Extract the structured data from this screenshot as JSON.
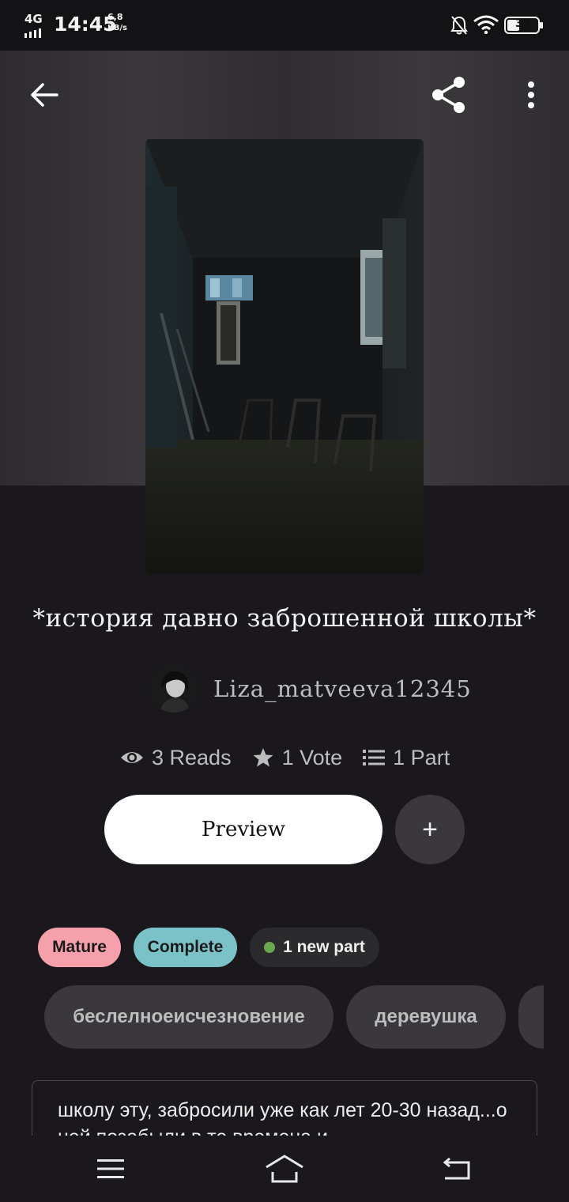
{
  "status_bar": {
    "network": "4G",
    "time": "14:45",
    "speed_value": "6,8",
    "speed_unit": "KB/s",
    "battery": "37"
  },
  "toolbar": {
    "back_icon": "arrow-left-icon",
    "share_icon": "share-icon",
    "more_icon": "more-vertical-icon"
  },
  "story": {
    "title": "*история давно заброшенной школы*",
    "author": "Liza_matveeva12345",
    "reads": "3 Reads",
    "votes": "1 Vote",
    "parts": "1 Part"
  },
  "actions": {
    "preview_label": "Preview",
    "add_label": "+"
  },
  "badges": [
    {
      "label": "Mature",
      "color": "#f5a0ab"
    },
    {
      "label": "Complete",
      "color": "#7bc2c8"
    },
    {
      "label": "1 new part",
      "dot_color": "#6aa84f"
    }
  ],
  "tags": [
    "беслелноеисчезновение",
    "деревушка"
  ],
  "description": "школу эту, забросили уже как лет 20-30 назад...о ней позабыли в те времена и...",
  "colors": {
    "background": "#1a181c",
    "chip": "#3a383c",
    "mature": "#f5a0ab",
    "complete": "#7bc2c8",
    "new_dot": "#6aa84f"
  },
  "nav_bar": {
    "menu_icon": "menu-icon",
    "home_icon": "home-icon",
    "back_icon": "back-icon"
  }
}
